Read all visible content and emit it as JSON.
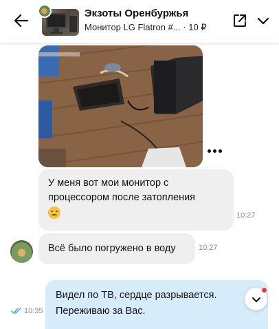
{
  "header": {
    "title": "Экзоты Оренбуржья",
    "listing": "Монитор LG Flatron #...",
    "separator": "·",
    "price": "10 ₽"
  },
  "messages": [
    {
      "direction": "incoming",
      "text_lines": [
        "У меня вот мои монитор с",
        "процессором после затопления"
      ],
      "emoji": "sad-face",
      "time": "10:27"
    },
    {
      "direction": "incoming",
      "text": "Всё было погружено в воду",
      "time": "10:27"
    },
    {
      "direction": "outgoing",
      "text_lines": [
        "Видел по ТВ, сердце разрывается.",
        "Переживаю за Вас."
      ],
      "time": "10:35",
      "status": "read"
    }
  ],
  "colors": {
    "incoming_bubble": "#efefef",
    "outgoing_bubble": "#d7ecfb",
    "read_check": "#4aa3e8",
    "badge": "#e53935"
  }
}
